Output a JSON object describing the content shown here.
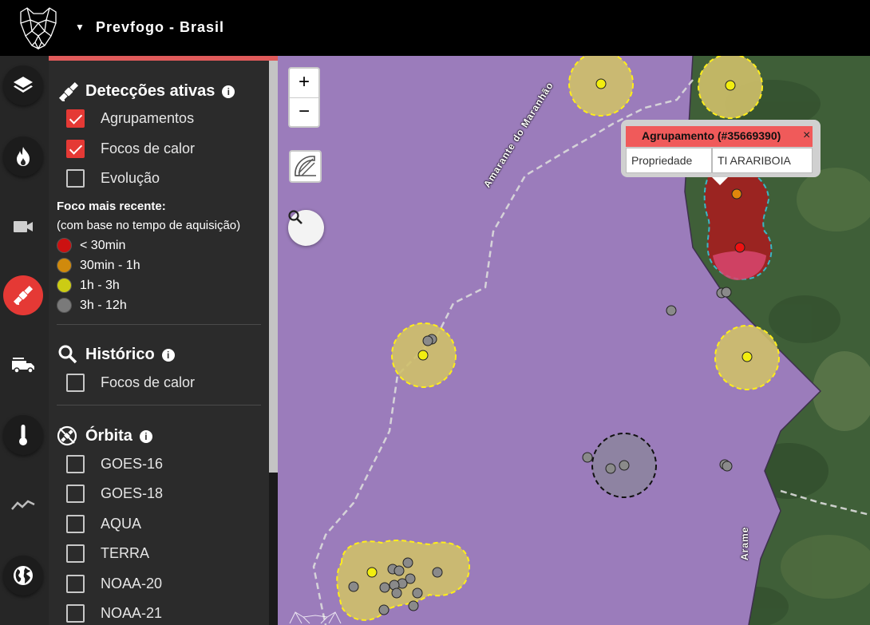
{
  "header": {
    "title": "Prevfogo - Brasil"
  },
  "rail": {
    "items": [
      {
        "name": "layers-icon"
      },
      {
        "name": "fire-icon"
      },
      {
        "name": "camera-icon"
      },
      {
        "name": "satellite-icon",
        "active": true
      },
      {
        "name": "fire-truck-icon"
      },
      {
        "name": "thermometer-icon"
      },
      {
        "name": "trend-icon"
      },
      {
        "name": "globe-icon"
      }
    ]
  },
  "panel": {
    "active_detections": {
      "title": "Detecções ativas",
      "options": [
        {
          "label": "Agrupamentos",
          "checked": true
        },
        {
          "label": "Focos de calor",
          "checked": true
        },
        {
          "label": "Evolução",
          "checked": false
        }
      ],
      "legend_title": "Foco mais recente:",
      "legend_subtitle": "(com base no tempo de aquisição)",
      "legend": [
        {
          "label": "< 30min",
          "color": "#cc1111"
        },
        {
          "label": "30min - 1h",
          "color": "#d08a0c"
        },
        {
          "label": "1h - 3h",
          "color": "#cccc14"
        },
        {
          "label": "3h - 12h",
          "color": "#7a7a7a"
        }
      ]
    },
    "history": {
      "title": "Histórico",
      "options": [
        {
          "label": "Focos de calor",
          "checked": false
        }
      ]
    },
    "orbit": {
      "title": "Órbita",
      "options": [
        {
          "label": "GOES-16",
          "checked": false
        },
        {
          "label": "GOES-18",
          "checked": false
        },
        {
          "label": "AQUA",
          "checked": false
        },
        {
          "label": "TERRA",
          "checked": false
        },
        {
          "label": "NOAA-20",
          "checked": false
        },
        {
          "label": "NOAA-21",
          "checked": false
        }
      ]
    }
  },
  "map": {
    "zoom_in": "+",
    "zoom_out": "−",
    "popup": {
      "title": "Agrupamento (#35669390)",
      "close": "×",
      "key": "Propriedade",
      "value": "TI ARARIBOIA"
    },
    "road_labels": [
      "Amarante do Maranhão",
      "Arame"
    ],
    "colors": {
      "territory": "#9b7cbb",
      "forest": "#3d5d36",
      "cluster_yellow": "#cfc06a",
      "cluster_red": "#a32020",
      "cluster_gray": "#8d84a0"
    }
  }
}
